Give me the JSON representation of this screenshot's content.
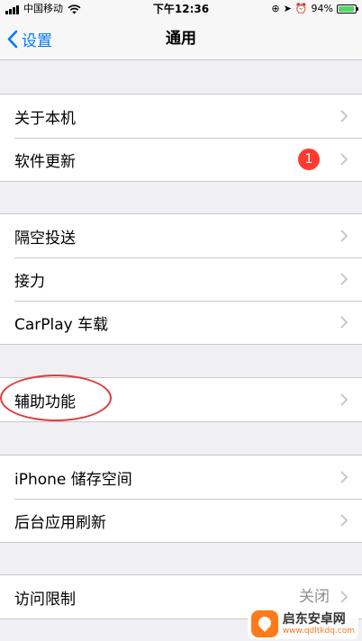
{
  "status_bar": {
    "carrier": "中国移动",
    "time": "下午12:36",
    "battery": "94%",
    "battery_color": "#4cd964"
  },
  "nav": {
    "back_label": "设置",
    "title": "通用"
  },
  "groups": [
    {
      "rows": [
        {
          "label": "关于本机"
        },
        {
          "label": "软件更新",
          "badge": "1"
        }
      ]
    },
    {
      "rows": [
        {
          "label": "隔空投送"
        },
        {
          "label": "接力"
        },
        {
          "label": "CarPlay 车载"
        }
      ]
    },
    {
      "rows": [
        {
          "label": "辅助功能"
        }
      ]
    },
    {
      "rows": [
        {
          "label": "iPhone 储存空间"
        },
        {
          "label": "后台应用刷新"
        }
      ]
    },
    {
      "rows": [
        {
          "label": "访问限制",
          "value": "关闭"
        }
      ]
    }
  ],
  "watermark": {
    "title": "启东安卓网",
    "url": "www.qdltkdq.com"
  },
  "colors": {
    "accent": "#007aff",
    "badge": "#ff3b30",
    "annotation": "#e03c3c"
  }
}
